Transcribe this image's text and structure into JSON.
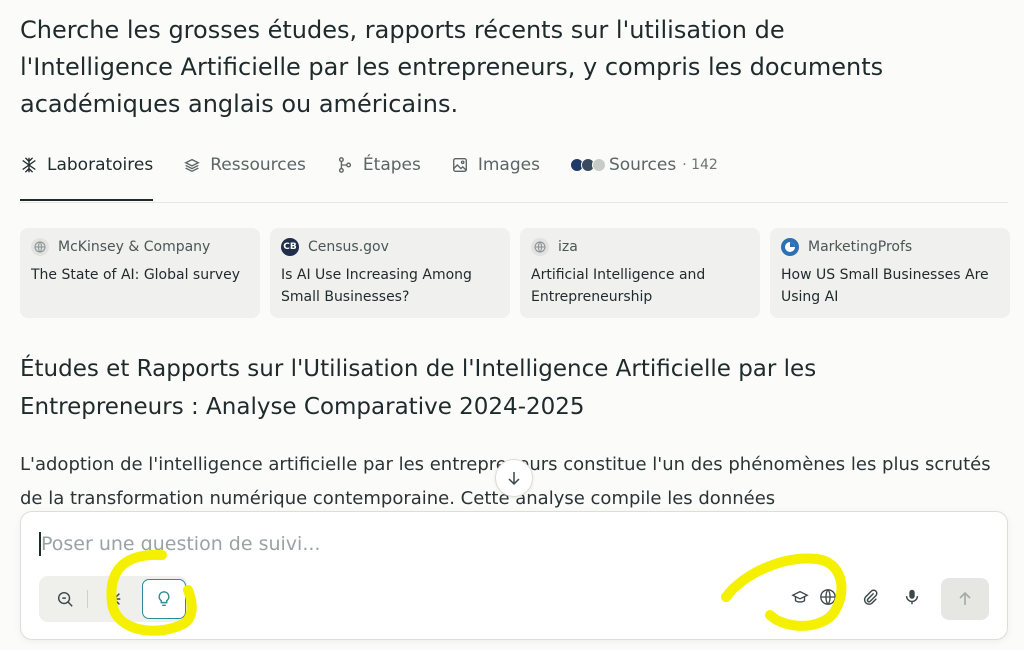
{
  "query": "Cherche les grosses études, rapports récents sur l'utilisation de l'Intelligence Artificielle par les entrepreneurs, y compris les documents académiques anglais ou américains.",
  "tabs": [
    {
      "label": "Laboratoires",
      "icon": "labs-icon"
    },
    {
      "label": "Ressources",
      "icon": "layers-icon"
    },
    {
      "label": "Étapes",
      "icon": "steps-icon"
    },
    {
      "label": "Images",
      "icon": "image-icon"
    },
    {
      "label": "Sources",
      "icon": "sources-icon",
      "count": "· 142"
    }
  ],
  "sources": [
    {
      "site": "McKinsey & Company",
      "title": "The State of AI: Global survey",
      "favicon": "globe-icon"
    },
    {
      "site": "Census.gov",
      "title": "Is AI Use Increasing Among Small Businesses?",
      "favicon": "census-logo",
      "favicon_text": "CB"
    },
    {
      "site": "iza",
      "title": "Artificial Intelligence and Entrepreneurship",
      "favicon": "globe-icon"
    },
    {
      "site": "MarketingProfs",
      "title": "How US Small Businesses Are Using AI",
      "favicon": "marketingprofs-logo"
    }
  ],
  "answer": {
    "heading": "Études et Rapports sur l'Utilisation de l'Intelligence Artificielle par les Entrepreneurs : Analyse Comparative 2024-2025",
    "paragraph": "L'adoption de l'intelligence artificielle par les entrepreneurs constitue l'un des phénomènes les plus scrutés de la transformation numérique contemporaine. Cette analyse compile les données"
  },
  "composer": {
    "placeholder": "Poser une question de suivi...",
    "modes": [
      "search-icon",
      "research-icon",
      "labs-bulb-icon"
    ],
    "active_mode": "labs-bulb-icon",
    "tools": [
      "academic-icon",
      "web-globe-icon",
      "attach-icon",
      "microphone-icon"
    ],
    "send_icon": "arrow-up-icon"
  },
  "colors": {
    "accent": "#2e8a94",
    "highlight": "#f5f000",
    "text": "#1f2a2c"
  }
}
